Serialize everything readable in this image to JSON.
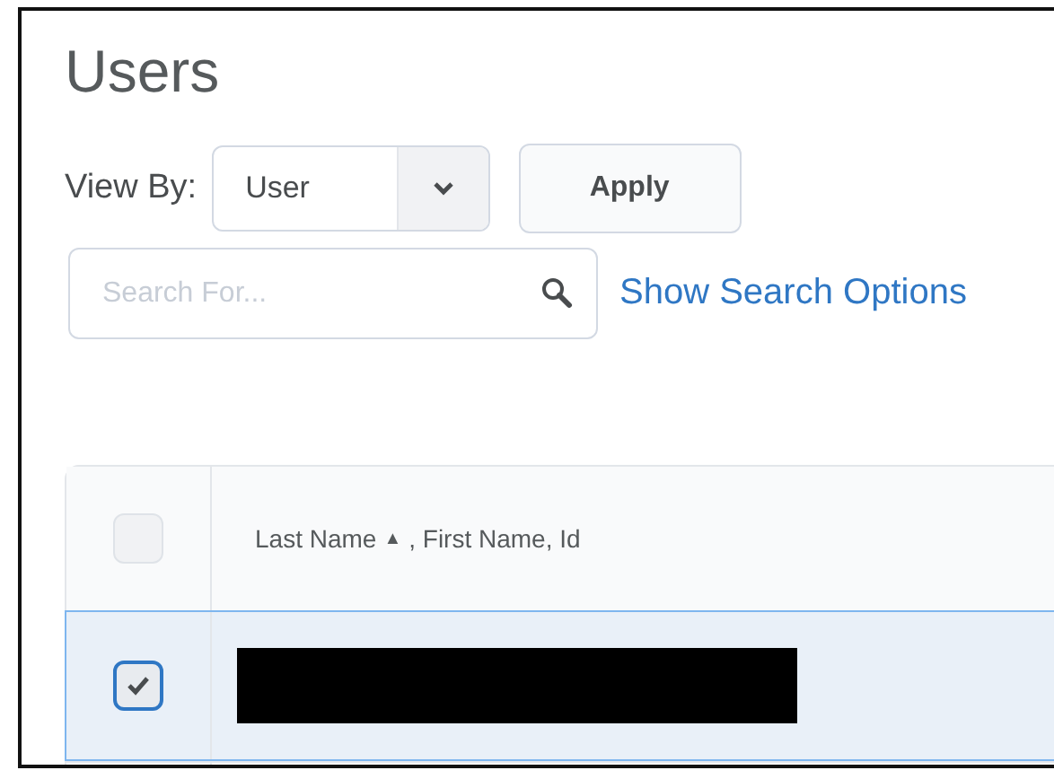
{
  "title": "Users",
  "view_by": {
    "label": "View By:",
    "value": "User",
    "button": "Apply"
  },
  "search": {
    "placeholder": "Search For...",
    "link": "Show Search Options"
  },
  "table": {
    "header": {
      "checked": false,
      "column": "Last Name",
      "sort_icon": "▲",
      "rest": ", First Name, Id"
    },
    "rows": [
      {
        "selected": true,
        "checked": true,
        "redacted": true
      }
    ]
  }
}
